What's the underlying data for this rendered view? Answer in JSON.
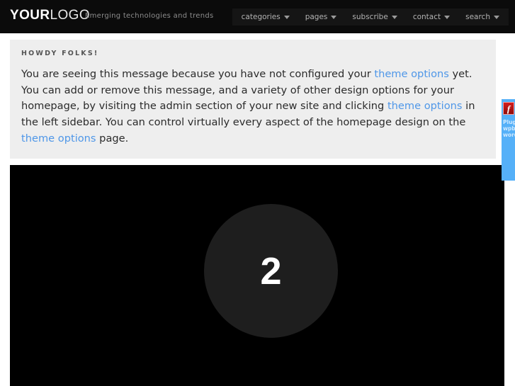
{
  "header": {
    "logo_strong": "YOUR",
    "logo_light": "LOGO",
    "tagline": "Emerging technologies and trends",
    "nav": [
      {
        "label": "categories",
        "icon": "chevron-down-icon"
      },
      {
        "label": "pages",
        "icon": "chevron-down-icon"
      },
      {
        "label": "subscribe",
        "icon": "chevron-down-icon"
      },
      {
        "label": "contact",
        "icon": "chevron-down-icon"
      },
      {
        "label": "search",
        "icon": "chevron-down-icon"
      }
    ]
  },
  "notice": {
    "title": "HOWDY FOLKS!",
    "seg1": "You are seeing this message because you have not configured your ",
    "link1": "theme options",
    "seg2": " yet. You can add or remove this message, and a variety of other design options for your homepage, by visiting the admin section of your new site and clicking ",
    "link2": "theme options",
    "seg3": " in the left sidebar. You can control virtually every aspect of the homepage design on the ",
    "link3": "theme options",
    "seg4": " page."
  },
  "slider": {
    "slide_number": "2"
  },
  "plugin_tab": {
    "icon": "flash-bolt-icon",
    "icon_glyph": "f",
    "text": "Plugin by wpbum.com wordpressthemes"
  },
  "colors": {
    "header_bg": "#0b0b0b",
    "nav_bg": "#151515",
    "notice_bg": "#eeeeee",
    "link": "#4f97e8",
    "slider_bg": "#000000",
    "circle": "#1e1e1e",
    "plugin_tab": "#55b0f8",
    "plugin_icon": "#d41d1d"
  }
}
